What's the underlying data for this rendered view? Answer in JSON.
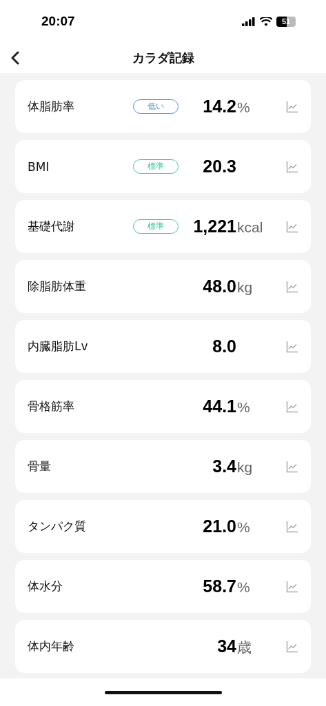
{
  "status_bar": {
    "time": "20:07",
    "battery": "51"
  },
  "header": {
    "title": "カラダ記録"
  },
  "metrics": [
    {
      "name": "体脂肪率",
      "badge": {
        "label": "低い",
        "color": "#4a8fe0"
      },
      "value": "14.2",
      "unit": "%"
    },
    {
      "name": "BMI",
      "badge": {
        "label": "標準",
        "color": "#3cc69a"
      },
      "value": "20.3"
    },
    {
      "name": "基礎代謝",
      "badge": {
        "label": "標準",
        "color": "#3cc69a"
      },
      "value": "1,221",
      "unit": "kcal"
    },
    {
      "name": "除脂肪体重",
      "value": "48.0",
      "unit": "kg"
    },
    {
      "name": "内臓脂肪Lv",
      "value": "8.0"
    },
    {
      "name": "骨格筋率",
      "value": "44.1",
      "unit": "%"
    },
    {
      "name": "骨量",
      "value": "3.4",
      "unit": "kg"
    },
    {
      "name": "タンパク質",
      "value": "21.0",
      "unit": "%"
    },
    {
      "name": "体水分",
      "value": "58.7",
      "unit": "%"
    },
    {
      "name": "体内年齢",
      "value": "34",
      "unit": "歳"
    }
  ]
}
